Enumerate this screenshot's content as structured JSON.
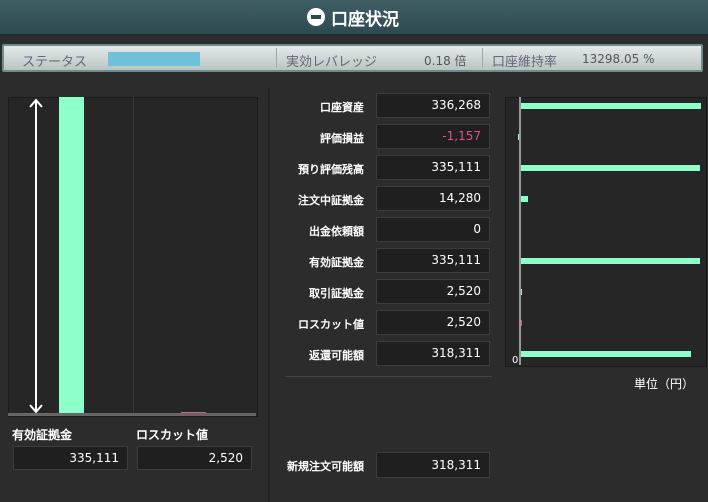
{
  "title": "口座状況",
  "status": {
    "label": "ステータス",
    "leverage_label": "実効レバレッジ",
    "leverage_value": "0.18 倍",
    "maintenance_label": "口座維持率",
    "maintenance_value": "13298.05 %"
  },
  "left_panel": {
    "margin_label": "有効証拠金",
    "margin_value": "335,111",
    "losscut_label": "ロスカット値",
    "losscut_value": "2,520"
  },
  "account_rows": [
    {
      "label": "口座資産",
      "value": "336,268"
    },
    {
      "label": "評価損益",
      "value": "-1,157"
    },
    {
      "label": "預り評価残高",
      "value": "335,111"
    },
    {
      "label": "注文中証拠金",
      "value": "14,280"
    },
    {
      "label": "出金依頼額",
      "value": "0"
    },
    {
      "label": "有効証拠金",
      "value": "335,111"
    },
    {
      "label": "取引証拠金",
      "value": "2,520"
    },
    {
      "label": "ロスカット値",
      "value": "2,520"
    },
    {
      "label": "返還可能額",
      "value": "318,311"
    }
  ],
  "new_order": {
    "label": "新規注文可能額",
    "value": "318,311"
  },
  "chart_data": {
    "type": "bar",
    "orientation": "horizontal",
    "categories": [
      "口座資産",
      "評価損益",
      "預り評価残高",
      "注文中証拠金",
      "出金依頼額",
      "有効証拠金",
      "取引証拠金",
      "ロスカット値",
      "返還可能額"
    ],
    "values": [
      336268,
      -1157,
      335111,
      14280,
      0,
      335111,
      2520,
      2520,
      318311
    ],
    "xlim": [
      0,
      336268
    ],
    "zero_label": "0",
    "unit": "単位（円）",
    "colors": {
      "positive": "#8fffc9",
      "negative": "#e0508a"
    }
  }
}
